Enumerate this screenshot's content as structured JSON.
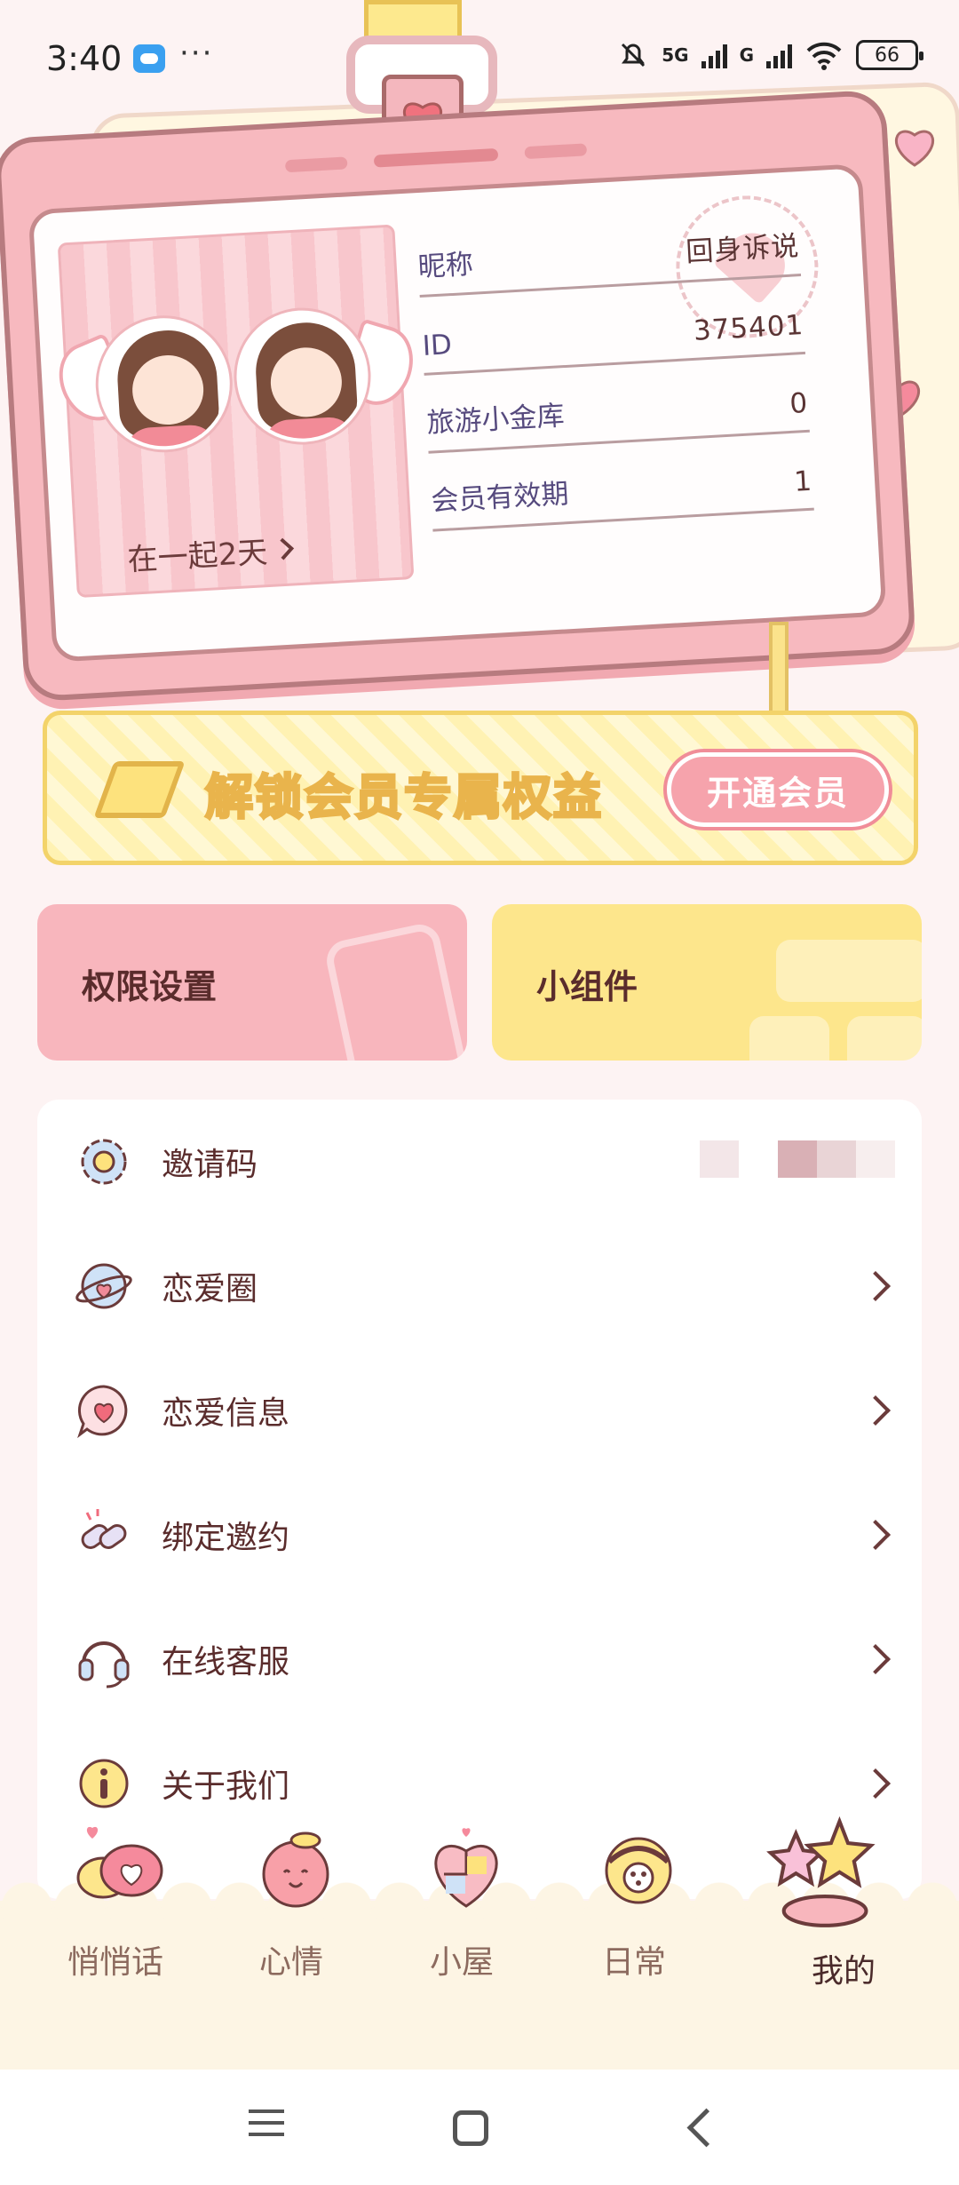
{
  "status_bar": {
    "time": "3:40",
    "more": "···",
    "network_1": "5G",
    "network_2": "G",
    "battery": "66"
  },
  "profile_card": {
    "together_text": "在一起2天",
    "fields": [
      {
        "label": "昵称",
        "value": "回身诉说"
      },
      {
        "label": "ID",
        "value": "375401"
      },
      {
        "label": "旅游小金库",
        "value": "0"
      },
      {
        "label": "会员有效期",
        "value": "1"
      }
    ]
  },
  "vip_banner": {
    "text": "解锁会员专属权益",
    "button": "开通会员"
  },
  "tiles": {
    "permissions": "权限设置",
    "widgets": "小组件"
  },
  "menu": [
    {
      "label": "邀请码",
      "icon": "gear-flower-icon"
    },
    {
      "label": "恋爱圈",
      "icon": "planet-heart-icon"
    },
    {
      "label": "恋爱信息",
      "icon": "heart-bubble-icon"
    },
    {
      "label": "绑定邀约",
      "icon": "link-icon"
    },
    {
      "label": "在线客服",
      "icon": "headset-icon"
    },
    {
      "label": "关于我们",
      "icon": "info-icon"
    }
  ],
  "tabs": [
    {
      "label": "悄悄话",
      "icon": "chat-hearts-icon"
    },
    {
      "label": "心情",
      "icon": "peach-icon"
    },
    {
      "label": "小屋",
      "icon": "puzzle-heart-icon"
    },
    {
      "label": "日常",
      "icon": "rotary-phone-icon"
    },
    {
      "label": "我的",
      "icon": "stars-icon",
      "active": true
    }
  ],
  "colors": {
    "pink": "#f7b9bf",
    "yellow": "#fde68c",
    "text_brown": "#5a2c2c",
    "label_purple": "#564a7e"
  }
}
